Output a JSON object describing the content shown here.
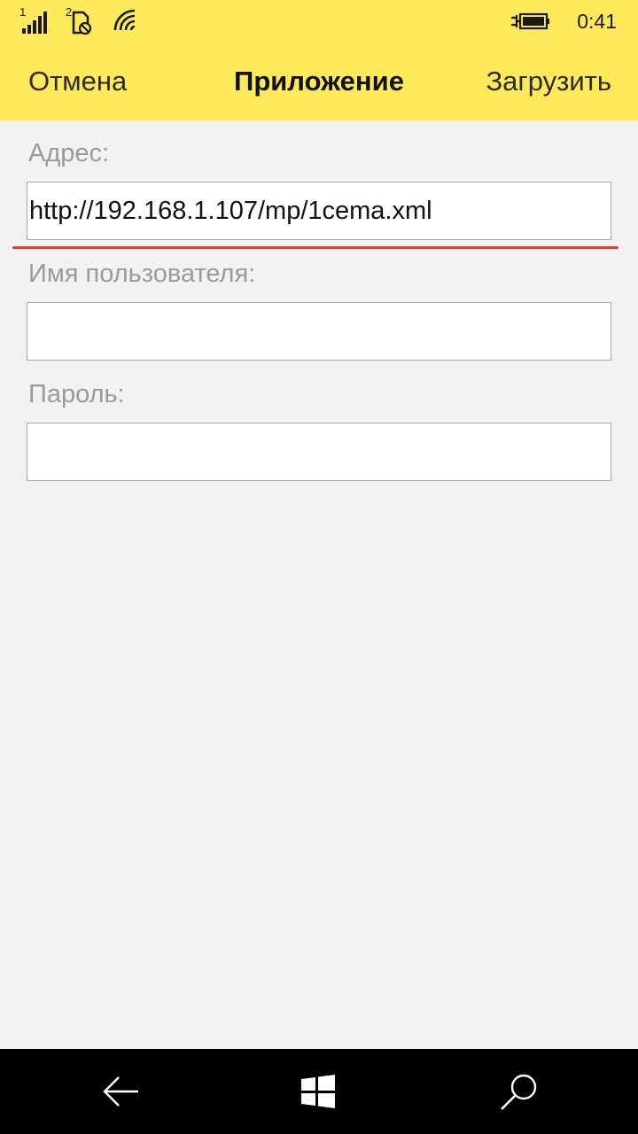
{
  "status_bar": {
    "sim1_label": "1",
    "sim2_label": "2",
    "time": "0:41",
    "icons": [
      "signal-strength-icon",
      "sim-no-signal-icon",
      "wifi-icon",
      "battery-charging-icon"
    ]
  },
  "header": {
    "cancel_label": "Отмена",
    "title": "Приложение",
    "upload_label": "Загрузить"
  },
  "form": {
    "address_label": "Адрес:",
    "address_value": "http://192.168.1.107/mp/1cema.xml",
    "username_label": "Имя пользователя:",
    "username_value": "",
    "password_label": "Пароль:",
    "password_value": ""
  },
  "nav_bar": {
    "icons": [
      "back-arrow-icon",
      "windows-start-icon",
      "search-icon"
    ]
  },
  "colors": {
    "accent": "#fde95a",
    "highlight": "#e53935",
    "background": "#f2f2f2"
  }
}
